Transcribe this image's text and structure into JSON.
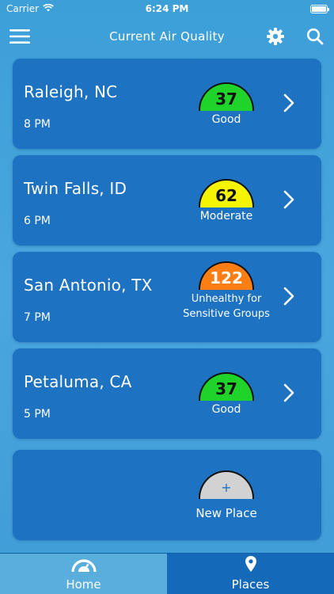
{
  "status": {
    "carrier": "Carrier",
    "time": "6:24 PM"
  },
  "header": {
    "title": "Current Air Quality"
  },
  "locations": [
    {
      "city": "Raleigh, NC",
      "time": "8 PM",
      "aqi": "37",
      "category": "Good",
      "color": "#1fd32a"
    },
    {
      "city": "Twin Falls, ID",
      "time": "6 PM",
      "aqi": "62",
      "category": "Moderate",
      "color": "#f5f500"
    },
    {
      "city": "San Antonio, TX",
      "time": "7 PM",
      "aqi": "122",
      "category": "Unhealthy for Sensitive Groups",
      "color": "#ff7e14"
    },
    {
      "city": "Petaluma, CA",
      "time": "5 PM",
      "aqi": "37",
      "category": "Good",
      "color": "#1fd32a"
    }
  ],
  "add_place": {
    "icon": "+",
    "label": "New Place"
  },
  "tabs": [
    {
      "label": "Home",
      "icon": "gauge-icon",
      "active": true
    },
    {
      "label": "Places",
      "icon": "location-pin-icon",
      "active": false
    }
  ],
  "colors": {
    "background": "#43a2da",
    "card": "#1d72c2",
    "tab_active": "#5aaedb",
    "tab_bar": "#1469b8"
  }
}
